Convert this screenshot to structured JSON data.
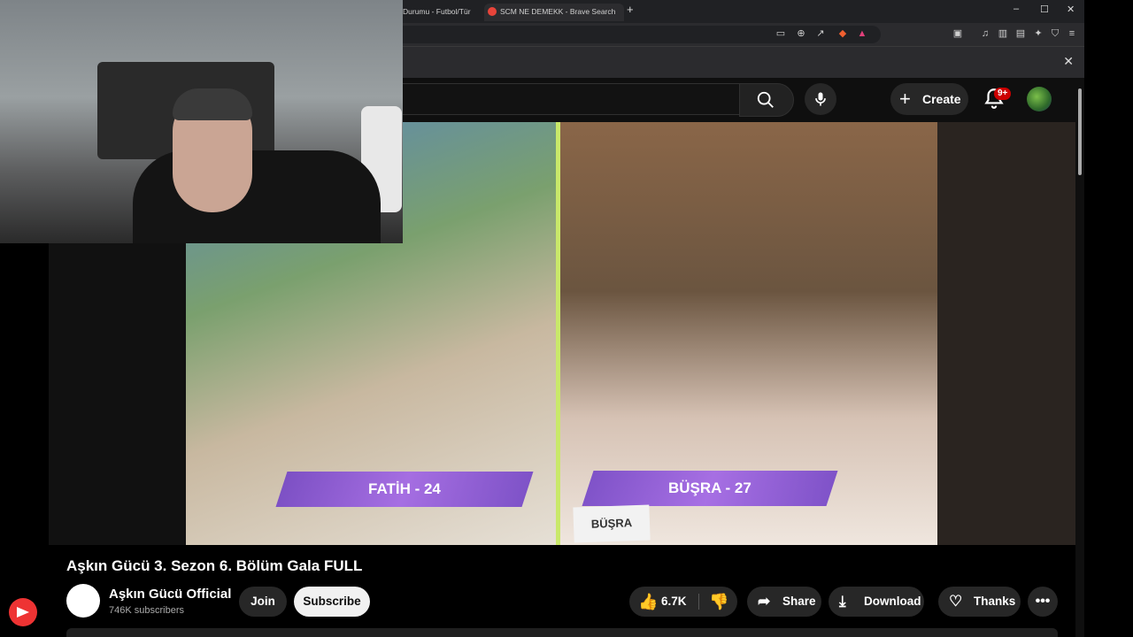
{
  "browser": {
    "tabs": [
      {
        "label": "Durumu - Futbol/Tür"
      },
      {
        "label": "SCM NE DEMEKK - Brave Search"
      }
    ],
    "new_tab_symbol": "+",
    "window_controls": {
      "minimize": "–",
      "maximize": "☐",
      "close": "✕"
    },
    "toolbar_icons": [
      "screen-cast-icon",
      "zoom-icon",
      "share-icon",
      "brave-shields-icon",
      "brave-rewards-icon",
      "media-icon",
      "sidebar-icon",
      "wallet-icon",
      "leo-ai-icon",
      "vpn-icon",
      "menu-icon"
    ],
    "infobar_close": "✕"
  },
  "youtube": {
    "header": {
      "create_label": "Create",
      "notifications_badge": "9+"
    },
    "video": {
      "lower_third_left": "FATİH - 24",
      "lower_third_right": "BÜŞRA - 27",
      "name_tag": "BÜŞRA"
    },
    "title": "Aşkın Gücü 3. Sezon 6. Bölüm Gala FULL",
    "channel": {
      "name": "Aşkın Gücü Official",
      "subscribers": "746K subscribers",
      "join_label": "Join",
      "subscribe_label": "Subscribe"
    },
    "actions": {
      "like_count": "6.7K",
      "share_label": "Share",
      "download_label": "Download",
      "thanks_label": "Thanks",
      "more_label": "•••"
    }
  }
}
